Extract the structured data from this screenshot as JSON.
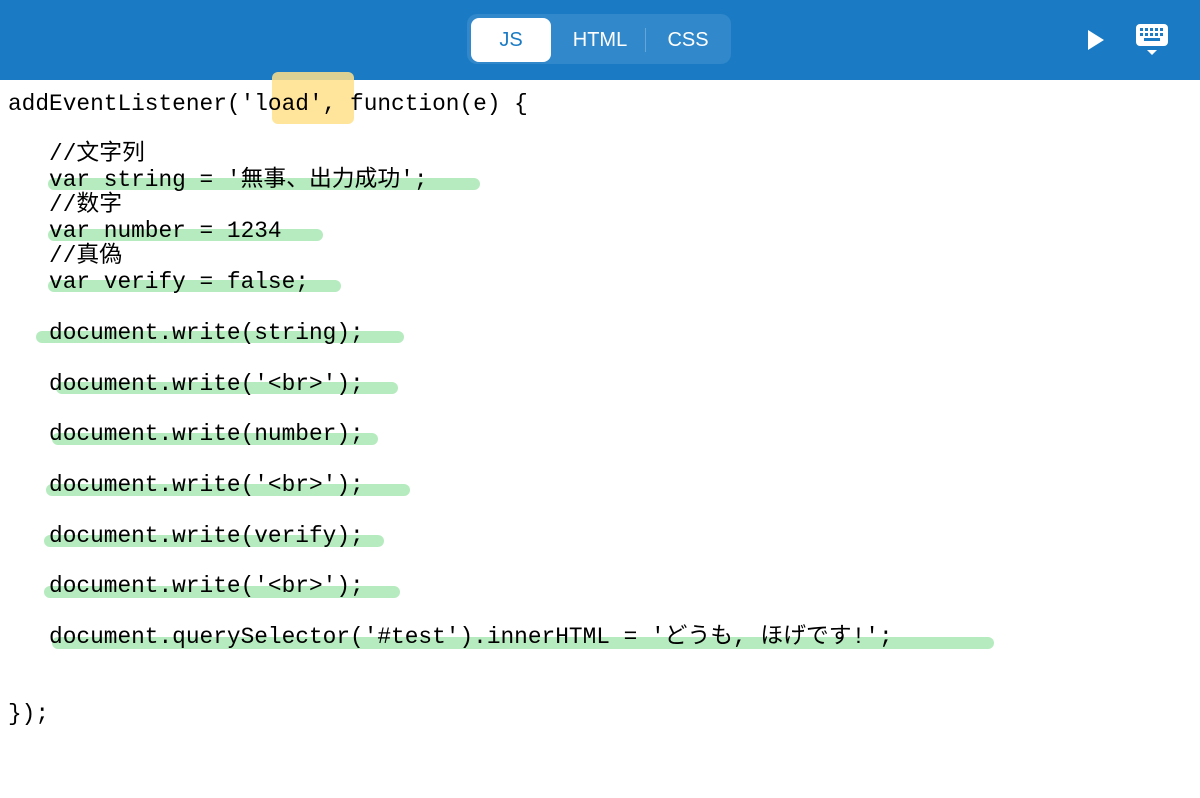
{
  "toolbar": {
    "tabs": [
      {
        "label": "JS",
        "active": true
      },
      {
        "label": "HTML",
        "active": false
      },
      {
        "label": "CSS",
        "active": false
      }
    ],
    "run_icon": "play-icon",
    "keyboard_icon": "keyboard-hide-icon",
    "background_color": "#1a7bc4"
  },
  "editor": {
    "lines": [
      "addEventListener('load', function(e) {",
      "   //文字列",
      "   var string = '無事、出力成功';",
      "   //数字",
      "   var number = 1234",
      "   //真偽",
      "   var verify = false;",
      "   document.write(string);",
      "   document.write('<br>');",
      "   document.write(number);",
      "   document.write('<br>');",
      "   document.write(verify);",
      "   document.write('<br>');",
      "   document.querySelector('#test').innerHTML = 'どうも, ほげです!';",
      "});"
    ],
    "highlight_colors": {
      "green": "#a9e8b4",
      "yellow": "#ffe08a"
    }
  }
}
